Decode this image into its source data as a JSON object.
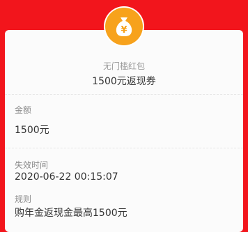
{
  "coupon": {
    "type_label": "无门槛红包",
    "name": "1500元返现券",
    "icon": "money-bag-icon",
    "icon_symbol": "¥",
    "accent_color": "#f7a21c"
  },
  "amount": {
    "label": "金额",
    "value": "1500元"
  },
  "expiry": {
    "label": "失效时间",
    "value": "2020-06-22 00:15:07"
  },
  "rules": {
    "label": "规则",
    "value": "购年金返现金最高1500元"
  },
  "colors": {
    "background": "#f2151c",
    "card": "#fbfbfb"
  }
}
